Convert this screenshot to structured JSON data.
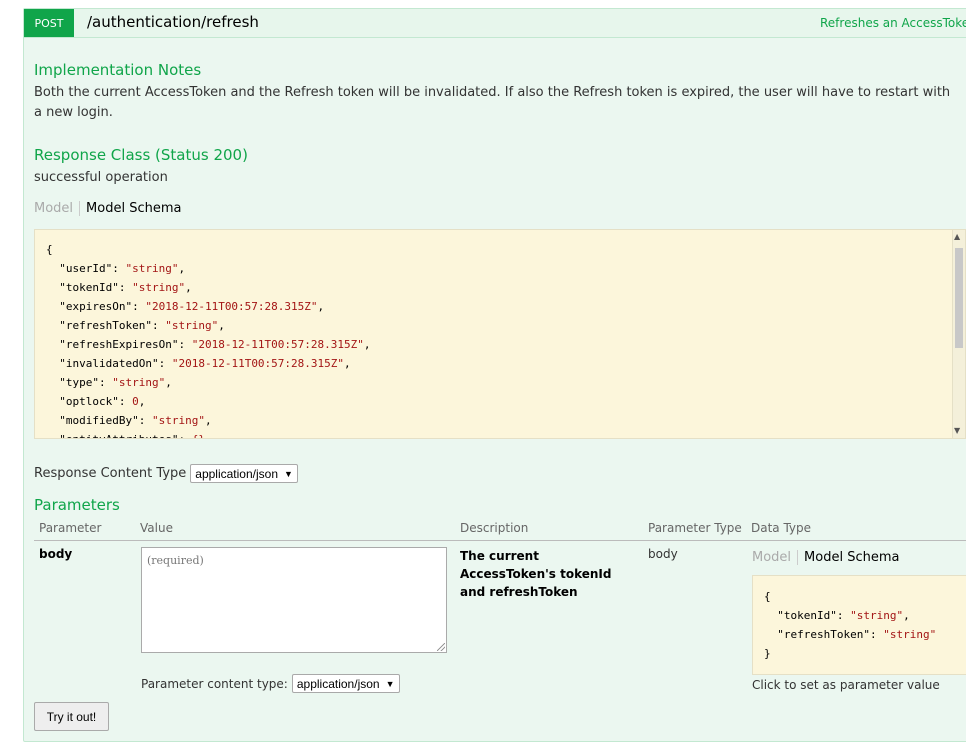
{
  "operation": {
    "method": "POST",
    "path": "/authentication/refresh",
    "summary": "Refreshes an AccessToken"
  },
  "implementation_notes": {
    "heading": "Implementation Notes",
    "text": "Both the current AccessToken and the Refresh token will be invalidated. If also the Refresh token is expired, the user will have to restart with a new login."
  },
  "response_class": {
    "heading": "Response Class (Status 200)",
    "description": "successful operation",
    "tab_model": "Model",
    "tab_model_schema": "Model Schema",
    "schema_lines": [
      {
        "key": "userId",
        "value": "\"string\""
      },
      {
        "key": "tokenId",
        "value": "\"string\""
      },
      {
        "key": "expiresOn",
        "value": "\"2018-12-11T00:57:28.315Z\""
      },
      {
        "key": "refreshToken",
        "value": "\"string\""
      },
      {
        "key": "refreshExpiresOn",
        "value": "\"2018-12-11T00:57:28.315Z\""
      },
      {
        "key": "invalidatedOn",
        "value": "\"2018-12-11T00:57:28.315Z\""
      },
      {
        "key": "type",
        "value": "\"string\""
      },
      {
        "key": "optlock",
        "value": "0"
      },
      {
        "key": "modifiedBy",
        "value": "\"string\""
      },
      {
        "key": "entityAttributes",
        "value": "{}"
      }
    ]
  },
  "response_content_type": {
    "label": "Response Content Type",
    "selected": "application/json"
  },
  "parameters": {
    "heading": "Parameters",
    "columns": {
      "parameter": "Parameter",
      "value": "Value",
      "description": "Description",
      "parameter_type": "Parameter Type",
      "data_type": "Data Type"
    },
    "rows": [
      {
        "name": "body",
        "placeholder": "(required)",
        "description": "The current AccessToken's tokenId and refreshToken",
        "parameter_type": "body",
        "tab_model": "Model",
        "tab_model_schema": "Model Schema",
        "schema_lines": [
          {
            "key": "tokenId",
            "value": "\"string\""
          },
          {
            "key": "refreshToken",
            "value": "\"string\""
          }
        ],
        "hint": "Click to set as parameter value",
        "content_type_label": "Parameter content type:",
        "content_type_selected": "application/json"
      }
    ]
  },
  "try_button": "Try it out!"
}
